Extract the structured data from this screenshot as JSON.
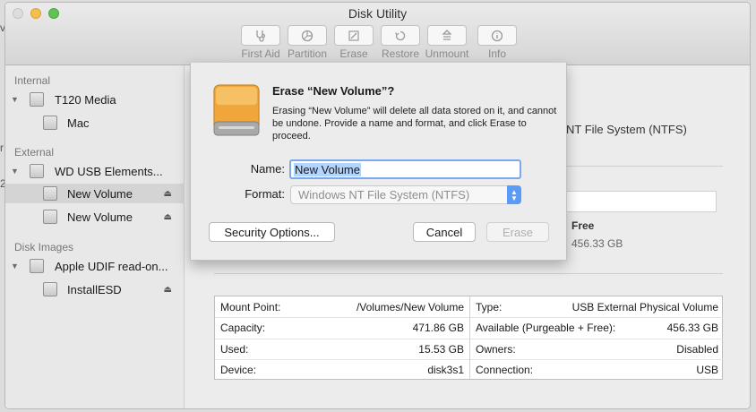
{
  "window": {
    "title": "Disk Utility"
  },
  "toolbar": {
    "items": [
      {
        "label": "First Aid",
        "icon": "stethoscope-icon"
      },
      {
        "label": "Partition",
        "icon": "partition-pie-icon"
      },
      {
        "label": "Erase",
        "icon": "erase-icon"
      },
      {
        "label": "Restore",
        "icon": "restore-icon"
      },
      {
        "label": "Unmount",
        "icon": "unmount-icon"
      },
      {
        "label": "Info",
        "icon": "info-icon"
      }
    ]
  },
  "sidebar": {
    "sections": {
      "internal": "Internal",
      "external": "External",
      "disk_images": "Disk Images"
    },
    "items": [
      {
        "label": "T120 Media"
      },
      {
        "label": "Mac"
      },
      {
        "label": "WD USB Elements..."
      },
      {
        "label": "New Volume",
        "selected": true
      },
      {
        "label": "New Volume"
      },
      {
        "label": "Apple UDIF read-on..."
      },
      {
        "label": "InstallESD"
      }
    ],
    "eject_glyph": "⏏"
  },
  "main": {
    "fragments": {
      "fs_suffix": "NT File System (NTFS)",
      "free_label": "Free",
      "free_value": "456.33 GB"
    },
    "info": {
      "left": [
        {
          "key": "Mount Point:",
          "value": "/Volumes/New Volume"
        },
        {
          "key": "Capacity:",
          "value": "471.86 GB"
        },
        {
          "key": "Used:",
          "value": "15.53 GB"
        },
        {
          "key": "Device:",
          "value": "disk3s1"
        }
      ],
      "right": [
        {
          "key": "Type:",
          "value": "USB External Physical Volume"
        },
        {
          "key": "Available (Purgeable + Free):",
          "value": "456.33 GB"
        },
        {
          "key": "Owners:",
          "value": "Disabled"
        },
        {
          "key": "Connection:",
          "value": "USB"
        }
      ]
    }
  },
  "dialog": {
    "title": "Erase “New Volume”?",
    "message": "Erasing “New Volume” will delete all data stored on it, and cannot be undone. Provide a name and format, and click Erase to proceed.",
    "name_label": "Name:",
    "name_value": "New Volume",
    "format_label": "Format:",
    "format_value": "Windows NT File System (NTFS)",
    "security_button": "Security Options...",
    "cancel_button": "Cancel",
    "erase_button": "Erase"
  },
  "colors": {
    "drive_orange": "#f0a63a",
    "selection_blue": "#b3d4fd",
    "focus_ring": "#7aa9f0",
    "stepper_blue": "#5a9bf7"
  }
}
